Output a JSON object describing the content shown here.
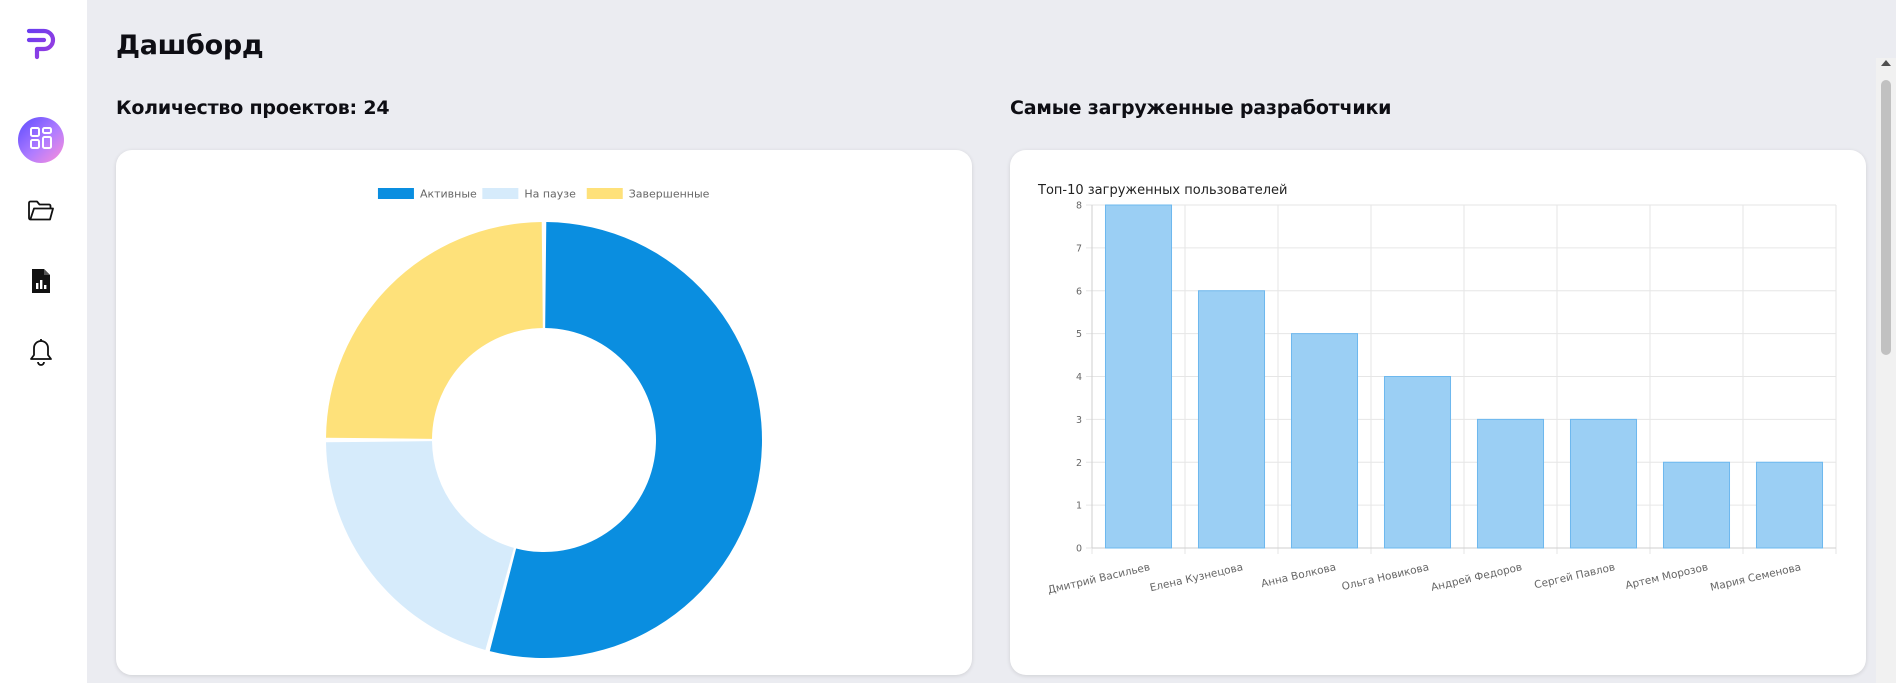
{
  "page": {
    "title": "Дашборд"
  },
  "sidebar": {
    "logo_icon": "brand-logo-icon",
    "items": [
      {
        "icon": "dashboard-icon",
        "active": true
      },
      {
        "icon": "folder-icon",
        "active": false
      },
      {
        "icon": "report-file-icon",
        "active": false
      },
      {
        "icon": "bell-icon",
        "active": false
      }
    ]
  },
  "projects": {
    "title": "Количество проектов: 24",
    "legend": [
      "Активные",
      "На паузе",
      "Завершенные"
    ]
  },
  "developers": {
    "title": "Самые загруженные разработчики"
  },
  "chart_data": [
    {
      "type": "pie",
      "variant": "doughnut",
      "labels": [
        "Активные",
        "На паузе",
        "Завершенные"
      ],
      "values": [
        13,
        5,
        6
      ],
      "colors": [
        "#0a8ee0",
        "#d6ebfb",
        "#fee17a"
      ],
      "legend_position": "top"
    },
    {
      "type": "bar",
      "title": "Топ-10 загруженных пользователей",
      "categories": [
        "Дмитрий Васильев",
        "Елена Кузнецова",
        "Анна Волкова",
        "Ольга Новикова",
        "Андрей Федоров",
        "Сергей Павлов",
        "Артем Морозов",
        "Мария Семенова"
      ],
      "values": [
        8,
        6,
        5,
        4,
        3,
        3,
        2,
        2
      ],
      "ylim": [
        0,
        8
      ],
      "yticks": [
        0,
        1,
        2,
        3,
        4,
        5,
        6,
        7,
        8
      ],
      "bar_color": "#9bcff4",
      "bar_border": "#6db8ee",
      "grid": true
    }
  ]
}
